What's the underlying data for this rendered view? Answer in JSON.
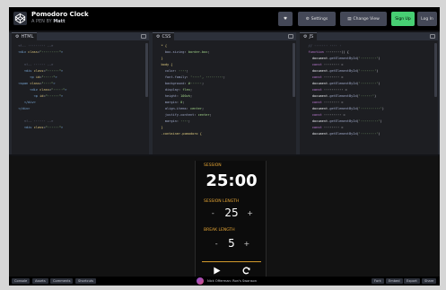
{
  "header": {
    "title": "Pomodoro Clock",
    "subtitle_prefix": "A PEN BY",
    "subtitle_author": "Matt",
    "buttons": {
      "like": "♥",
      "settings": "Settings",
      "change_view": "Change View",
      "signup": "Sign Up",
      "login": "Log In"
    }
  },
  "editors": {
    "html": {
      "label": "HTML"
    },
    "css": {
      "label": "CSS"
    },
    "js": {
      "label": "JS"
    }
  },
  "timer": {
    "session_label": "SESSION",
    "time": "25:00",
    "session_length_label": "SESSION LENGTH",
    "session_length": "25",
    "break_length_label": "BREAK LENGTH",
    "break_length": "5",
    "minus": "-",
    "plus": "+",
    "play_icon": "play-icon",
    "reset_icon": "refresh-icon",
    "accent_color": "#e8a735"
  },
  "footer": {
    "console": "Console",
    "assets": "Assets",
    "comments": "Comments",
    "shortcuts": "Shortcuts",
    "now_playing": "Nick Offerman: Ron's Swanson",
    "fork": "Fork",
    "embed": "Embed",
    "export": "Export",
    "share": "Share"
  }
}
